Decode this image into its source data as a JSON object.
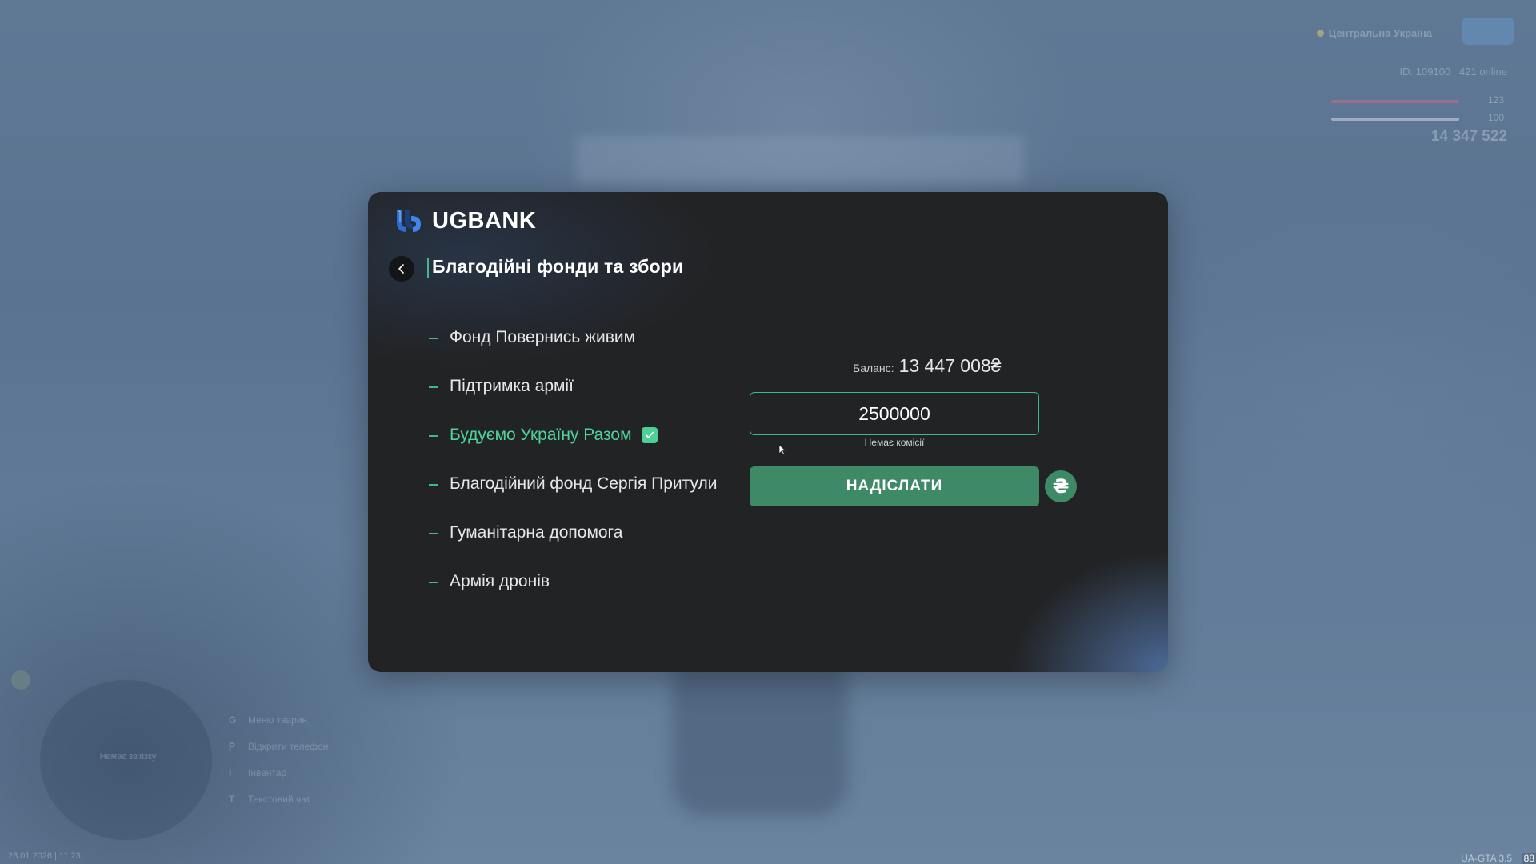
{
  "brand": {
    "name": "UGBANK"
  },
  "page": {
    "title": "Благодійні фонди та збори"
  },
  "funds": [
    {
      "label": "Фонд Повернись живим",
      "selected": false
    },
    {
      "label": "Підтримка армії",
      "selected": false
    },
    {
      "label": "Будуємо Україну Разом",
      "selected": true
    },
    {
      "label": "Благодійний фонд Сергія Притули",
      "selected": false
    },
    {
      "label": "Гуманітарна допомога",
      "selected": false
    },
    {
      "label": "Армія дронів",
      "selected": false
    }
  ],
  "transfer": {
    "balance_label": "Баланс:",
    "balance_value": "13 447 008₴",
    "amount_value": "2500000",
    "fee_note": "Немає комісії",
    "send_label": "НАДІСЛАТИ",
    "currency_symbol": "₴"
  },
  "hud": {
    "region": "Центральна Україна",
    "id_text": "ID: 109100",
    "online_text": "421 online",
    "hp_value": "123",
    "armor_value": "100",
    "money": "14 347 522",
    "keys": [
      {
        "key": "G",
        "label": "Меню тварин"
      },
      {
        "key": "P",
        "label": "Відкрити телефон"
      },
      {
        "key": "I",
        "label": "Інвентар"
      },
      {
        "key": "T",
        "label": "Текстовий чат"
      }
    ],
    "minimap_text": "Немає зв'язку",
    "datetime": "28.01.2026 | 11:23",
    "version": "UA-GTA 3.5",
    "fps": "88"
  },
  "colors": {
    "accent": "#3fb98b",
    "button": "#3f8a66",
    "modal_bg": "#222325"
  }
}
